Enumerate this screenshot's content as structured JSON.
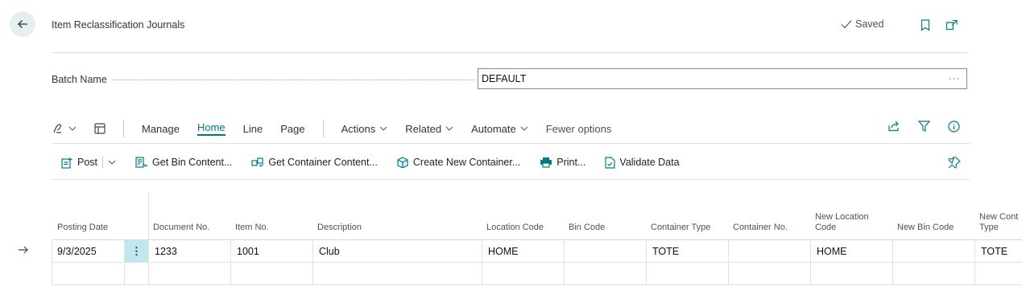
{
  "header": {
    "title": "Item Reclassification Journals",
    "saved_label": "Saved"
  },
  "batch": {
    "label": "Batch Name",
    "value": "DEFAULT",
    "more": "···"
  },
  "actionbar": {
    "manage": "Manage",
    "home": "Home",
    "line": "Line",
    "page": "Page",
    "actions": "Actions",
    "related": "Related",
    "automate": "Automate",
    "fewer": "Fewer options"
  },
  "commands": {
    "post": "Post",
    "get_bin": "Get Bin Content...",
    "get_container": "Get Container Content...",
    "create_container": "Create New Container...",
    "print": "Print...",
    "validate": "Validate Data"
  },
  "columns": {
    "posting_date": "Posting Date",
    "document_no": "Document No.",
    "item_no": "Item No.",
    "description": "Description",
    "location_code": "Location Code",
    "bin_code": "Bin Code",
    "container_type": "Container Type",
    "container_no": "Container No.",
    "new_location_1": "New Location",
    "new_location_2": "Code",
    "new_bin_code": "New Bin Code",
    "new_cont_1": "New Cont",
    "new_cont_2": "Type"
  },
  "rows": [
    {
      "posting_date": "9/3/2025",
      "document_no": "1233",
      "item_no": "1001",
      "description": "Club",
      "location_code": "HOME",
      "bin_code": "",
      "container_type": "TOTE",
      "container_no": "",
      "new_location_code": "HOME",
      "new_bin_code": "",
      "new_container_type": "TOTE"
    }
  ],
  "row_menu": "⋮",
  "colors": {
    "accent": "#007a80",
    "selected_cell": "#bfe8ee"
  }
}
